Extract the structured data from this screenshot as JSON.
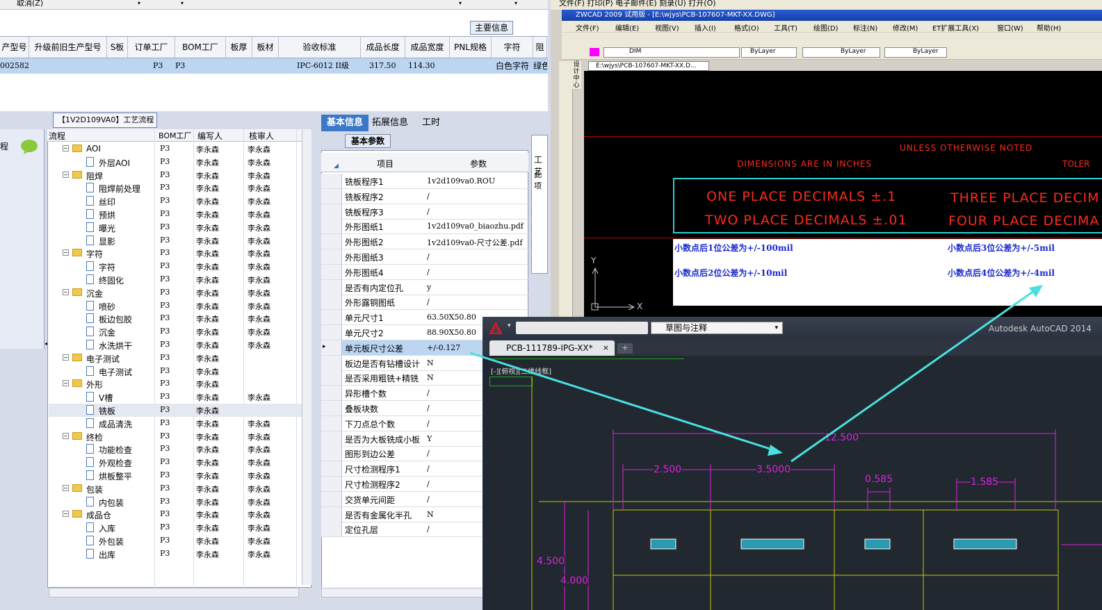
{
  "top_bar": {
    "cancel": "取消(Z)"
  },
  "main_info_tab": "主要信息",
  "grid": {
    "headers": [
      "产型号",
      "升级前旧生产型号",
      "S板",
      "订单工厂",
      "BOM工厂",
      "板厚",
      "板材",
      "验收标准",
      "成品长度",
      "成品宽度",
      "PNL规格",
      "字符",
      "阻"
    ],
    "row": [
      "002582",
      "",
      "",
      "P3",
      "P3",
      "",
      "",
      "IPC-6012 II级",
      "317.50",
      "114.30",
      "",
      "白色字符",
      "绿色"
    ]
  },
  "process_panel": {
    "title": "【1V2D109VA0】工艺流程",
    "side_label": "程",
    "columns": [
      "流程",
      "BOM工厂",
      "编写人",
      "核审人"
    ],
    "rows": [
      {
        "label": "AOI",
        "lvl": 0,
        "type": "folder",
        "bom": "P3",
        "w": "李永森",
        "r": "李永森"
      },
      {
        "label": "外层AOI",
        "lvl": 1,
        "type": "doc",
        "bom": "P3",
        "w": "李永森",
        "r": "李永森"
      },
      {
        "label": "阻焊",
        "lvl": 0,
        "type": "folder",
        "bom": "P3",
        "w": "李永森",
        "r": "李永森"
      },
      {
        "label": "阻焊前处理",
        "lvl": 1,
        "type": "doc",
        "bom": "P3",
        "w": "李永森",
        "r": "李永森"
      },
      {
        "label": "丝印",
        "lvl": 1,
        "type": "doc",
        "bom": "P3",
        "w": "李永森",
        "r": "李永森"
      },
      {
        "label": "预烘",
        "lvl": 1,
        "type": "doc",
        "bom": "P3",
        "w": "李永森",
        "r": "李永森"
      },
      {
        "label": "曝光",
        "lvl": 1,
        "type": "doc",
        "bom": "P3",
        "w": "李永森",
        "r": "李永森"
      },
      {
        "label": "显影",
        "lvl": 1,
        "type": "doc",
        "bom": "P3",
        "w": "李永森",
        "r": "李永森"
      },
      {
        "label": "字符",
        "lvl": 0,
        "type": "folder",
        "bom": "P3",
        "w": "李永森",
        "r": "李永森"
      },
      {
        "label": "字符",
        "lvl": 1,
        "type": "doc",
        "bom": "P3",
        "w": "李永森",
        "r": "李永森"
      },
      {
        "label": "终固化",
        "lvl": 1,
        "type": "doc",
        "bom": "P3",
        "w": "李永森",
        "r": "李永森"
      },
      {
        "label": "沉金",
        "lvl": 0,
        "type": "folder",
        "bom": "P3",
        "w": "李永森",
        "r": "李永森"
      },
      {
        "label": "喷砂",
        "lvl": 1,
        "type": "doc",
        "bom": "P3",
        "w": "李永森",
        "r": "李永森"
      },
      {
        "label": "板边包胶",
        "lvl": 1,
        "type": "doc",
        "bom": "P3",
        "w": "李永森",
        "r": "李永森"
      },
      {
        "label": "沉金",
        "lvl": 1,
        "type": "doc",
        "bom": "P3",
        "w": "李永森",
        "r": "李永森"
      },
      {
        "label": "水洗烘干",
        "lvl": 1,
        "type": "doc",
        "bom": "P3",
        "w": "李永森",
        "r": "李永森"
      },
      {
        "label": "电子测试",
        "lvl": 0,
        "type": "folder",
        "bom": "P3",
        "w": "李永森",
        "r": ""
      },
      {
        "label": "电子测试",
        "lvl": 1,
        "type": "doc",
        "bom": "P3",
        "w": "李永森",
        "r": ""
      },
      {
        "label": "外形",
        "lvl": 0,
        "type": "folder",
        "bom": "P3",
        "w": "李永森",
        "r": ""
      },
      {
        "label": "V槽",
        "lvl": 1,
        "type": "doc",
        "bom": "P3",
        "w": "李永森",
        "r": "李永森"
      },
      {
        "label": "铣板",
        "lvl": 1,
        "type": "doc",
        "bom": "P3",
        "w": "李永森",
        "r": ""
      },
      {
        "label": "成品清洗",
        "lvl": 1,
        "type": "doc",
        "bom": "P3",
        "w": "李永森",
        "r": "李永森"
      },
      {
        "label": "终检",
        "lvl": 0,
        "type": "folder",
        "bom": "P3",
        "w": "李永森",
        "r": "李永森"
      },
      {
        "label": "功能检查",
        "lvl": 1,
        "type": "doc",
        "bom": "P3",
        "w": "李永森",
        "r": "李永森"
      },
      {
        "label": "外观检查",
        "lvl": 1,
        "type": "doc",
        "bom": "P3",
        "w": "李永森",
        "r": "李永森"
      },
      {
        "label": "烘板整平",
        "lvl": 1,
        "type": "doc",
        "bom": "P3",
        "w": "李永森",
        "r": "李永森"
      },
      {
        "label": "包装",
        "lvl": 0,
        "type": "folder",
        "bom": "P3",
        "w": "李永森",
        "r": "李永森"
      },
      {
        "label": "内包装",
        "lvl": 1,
        "type": "doc",
        "bom": "P3",
        "w": "李永森",
        "r": "李永森"
      },
      {
        "label": "成品仓",
        "lvl": 0,
        "type": "folder",
        "bom": "P3",
        "w": "李永森",
        "r": "李永森"
      },
      {
        "label": "入库",
        "lvl": 1,
        "type": "doc",
        "bom": "P3",
        "w": "李永森",
        "r": "李永森"
      },
      {
        "label": "外包装",
        "lvl": 1,
        "type": "doc",
        "bom": "P3",
        "w": "李永森",
        "r": "李永森"
      },
      {
        "label": "出库",
        "lvl": 1,
        "type": "doc",
        "bom": "P3",
        "w": "李永森",
        "r": "李永森"
      }
    ]
  },
  "params_panel": {
    "tabs": [
      "基本信息",
      "拓展信息",
      "工时"
    ],
    "subtab": "基本参数",
    "col_item": "项目",
    "col_param": "参数",
    "side_tab": "工艺",
    "side_text": "此项",
    "rows": [
      {
        "k": "铣板程序1",
        "v": "1v2d109va0.ROU"
      },
      {
        "k": "铣板程序2",
        "v": "/"
      },
      {
        "k": "铣板程序3",
        "v": "/"
      },
      {
        "k": "外形图纸1",
        "v": "1v2d109va0_biaozhu.pdf"
      },
      {
        "k": "外形图纸2",
        "v": "1v2d109va0-尺寸公差.pdf"
      },
      {
        "k": "外形图纸3",
        "v": "/"
      },
      {
        "k": "外形图纸4",
        "v": "/"
      },
      {
        "k": "是否有内定位孔",
        "v": "y"
      },
      {
        "k": "外形露铜图纸",
        "v": "/"
      },
      {
        "k": "单元尺寸1",
        "v": "63.50X50.80"
      },
      {
        "k": "单元尺寸2",
        "v": "88.90X50.80"
      },
      {
        "k": "单元板尺寸公差",
        "v": "+/-0.127"
      },
      {
        "k": "板边是否有钻槽设计",
        "v": "N"
      },
      {
        "k": "是否采用粗铣+精铣",
        "v": "N"
      },
      {
        "k": "异形槽个数",
        "v": "/"
      },
      {
        "k": "叠板块数",
        "v": "/"
      },
      {
        "k": "下刀点总个数",
        "v": "/"
      },
      {
        "k": "是否为大板铣成小板",
        "v": "Y"
      },
      {
        "k": "图形到边公差",
        "v": "/"
      },
      {
        "k": "尺寸检测程序1",
        "v": "/"
      },
      {
        "k": "尺寸检测程序2",
        "v": "/"
      },
      {
        "k": "交货单元间距",
        "v": "/"
      },
      {
        "k": "是否有金属化半孔",
        "v": "N"
      },
      {
        "k": "定位孔层",
        "v": "/"
      }
    ]
  },
  "zwcad": {
    "topmenu": "文件(F)    打印(P)    电子邮件(E)    刻录(U)    打开(O)",
    "title": "ZWCAD 2009 试用版 - [E:\\wjys\\PCB-107607-MKT-XX.DWG]",
    "menu": [
      "文件(F)",
      "编辑(E)",
      "视图(V)",
      "插入(I)",
      "格式(O)",
      "工具(T)",
      "绘图(D)",
      "标注(N)",
      "修改(M)",
      "ET扩展工具(X)",
      "窗口(W)",
      "帮助(H)"
    ],
    "layer": "DIM",
    "bylayer": "ByLayer",
    "design_center": "设计中心",
    "doc_tab": "E:\\wjys\\PCB-107607-MKT-XX.D...",
    "unless": "UNLESS OTHERWISE NOTED",
    "dims": "DIMENSIONS ARE IN INCHES",
    "toler": "TOLER",
    "one": "ONE PLACE DECIMALS ±.1",
    "two": "TWO PLACE DECIMALS ±.01",
    "three": "THREE PLACE DECIM",
    "four": "FOUR PLACE DECIMA",
    "n1": "小数点后1位公差为+/-100mil",
    "n2": "小数点后2位公差为+/-10mil",
    "n3": "小数点后3位公差为+/-5mil",
    "n4": "小数点后4位公差为+/-4mil",
    "axis_y": "Y",
    "axis_x": "X"
  },
  "autocad": {
    "workspace": "草图与注释",
    "app": "Autodesk AutoCAD 2014",
    "tab": "PCB-111789-IPG-XX*",
    "view": "[-][俯视][二维线框]",
    "dims": [
      "12.500",
      "2.500",
      "3.5000",
      "0.585",
      "1.585",
      "4.500",
      "4.000"
    ]
  }
}
